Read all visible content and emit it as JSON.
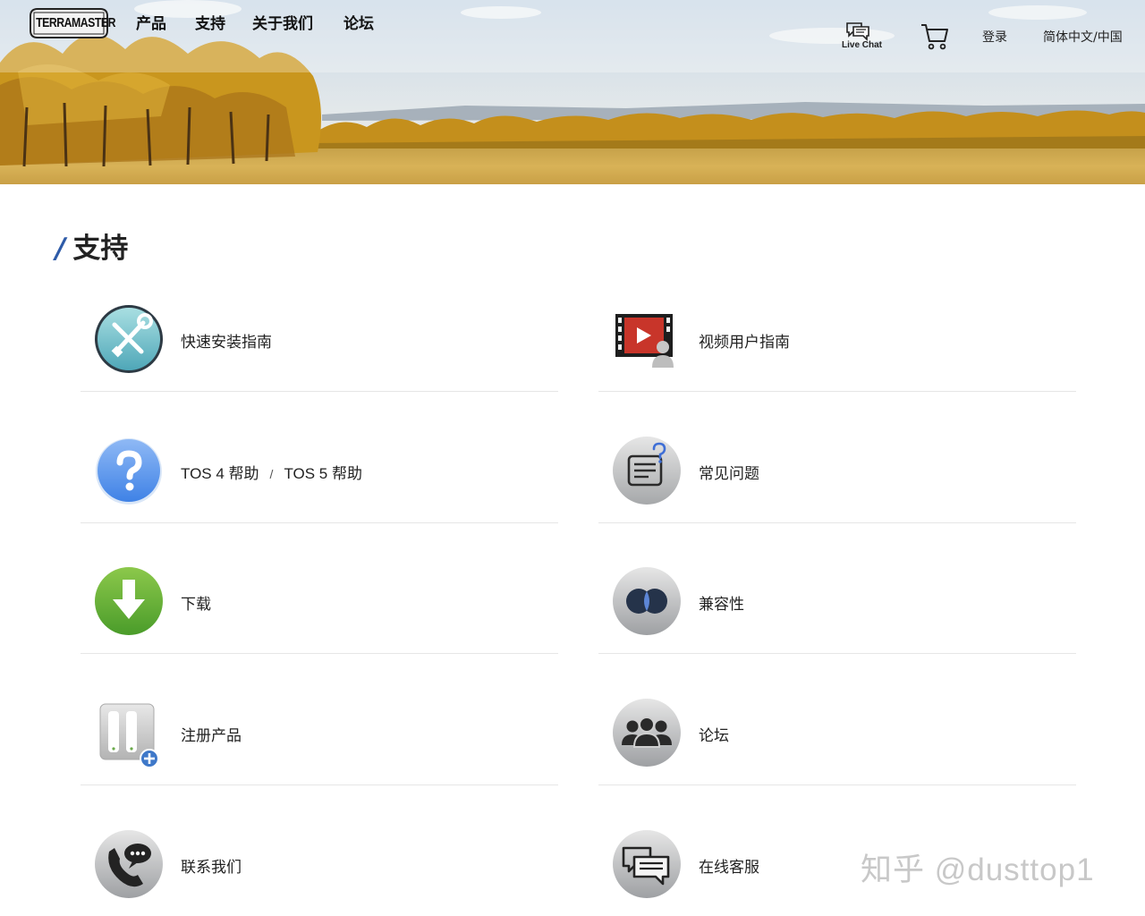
{
  "brand": {
    "logo_text": "TERRAMASTER"
  },
  "nav": {
    "links": [
      "产品",
      "支持",
      "关于我们",
      "论坛"
    ],
    "live_chat": "Live Chat",
    "login": "登录",
    "language": "简体中文/中国"
  },
  "page": {
    "title": "支持"
  },
  "support_items": [
    {
      "label": "快速安装指南",
      "icon": "tools-icon"
    },
    {
      "label": "视频用户指南",
      "icon": "video-guide-icon"
    },
    {
      "label_a": "TOS 4 帮助",
      "separator": "/",
      "label_b": "TOS 5 帮助",
      "icon": "help-question-icon"
    },
    {
      "label": "常见问题",
      "icon": "faq-icon"
    },
    {
      "label": "下载",
      "icon": "download-icon"
    },
    {
      "label": "兼容性",
      "icon": "compatibility-icon"
    },
    {
      "label": "注册产品",
      "icon": "register-product-icon"
    },
    {
      "label": "论坛",
      "icon": "forum-icon"
    },
    {
      "label": "联系我们",
      "icon": "contact-phone-icon"
    },
    {
      "label": "在线客服",
      "icon": "online-chat-icon"
    }
  ],
  "watermark": "知乎 @dusttop1",
  "colors": {
    "accent_slash": "#2e5ba8",
    "download_green": "#5aa834",
    "help_blue": "#3f82e6"
  }
}
